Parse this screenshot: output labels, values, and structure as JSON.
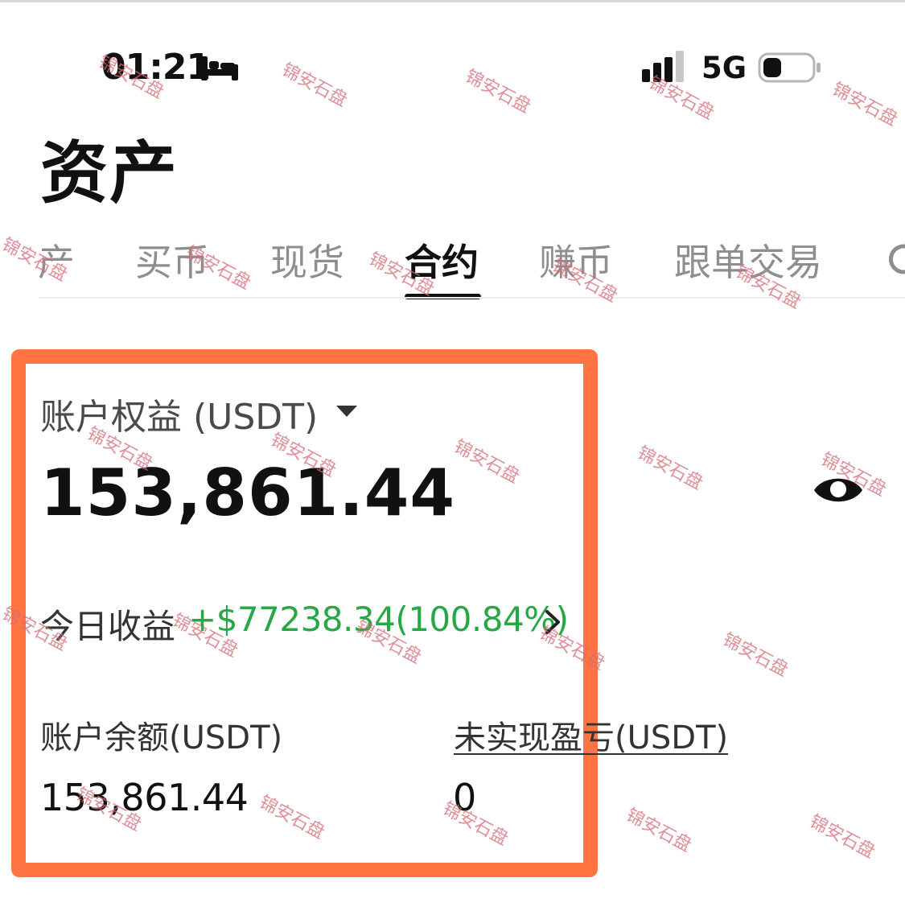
{
  "status_bar": {
    "time": "01:21",
    "network": "5G",
    "icons": [
      "bed-icon",
      "signal-icon",
      "battery-icon"
    ]
  },
  "page": {
    "title": "资产"
  },
  "tabs": [
    {
      "label": "产",
      "active": false
    },
    {
      "label": "买币",
      "active": false
    },
    {
      "label": "现货",
      "active": false
    },
    {
      "label": "合约",
      "active": true
    },
    {
      "label": "赚币",
      "active": false
    },
    {
      "label": "跟单交易",
      "active": false
    }
  ],
  "account": {
    "equity_label": "账户权益 (USDT)",
    "equity_value": "153,861.44",
    "today_label": "今日收益",
    "today_value": "+$77238.34(100.84%)",
    "balance_label": "账户余额(USDT)",
    "balance_value": "153,861.44",
    "pnl_label": "未实现盈亏(USDT)",
    "pnl_value": "0"
  },
  "watermark": {
    "text": "锦安石盘",
    "color": "#d66a74"
  },
  "colors": {
    "highlight": "#ff7440",
    "profit_green": "#28a745",
    "active_tab": "#111111",
    "inactive_tab": "#8e8e8e"
  }
}
